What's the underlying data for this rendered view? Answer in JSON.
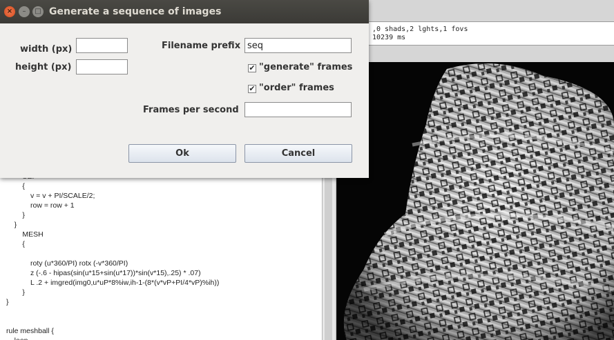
{
  "dialog": {
    "title": "Generate a sequence of images",
    "window_buttons": {
      "close": "×",
      "minimize": "–",
      "maximize": "□"
    },
    "width_label": "width (px)",
    "height_label": "height (px)",
    "width_value": "",
    "height_value": "",
    "prefix_label": "Filename prefix",
    "prefix_value": "seq",
    "generate_label": "\"generate\" frames",
    "generate_checked": true,
    "order_label": "\"order\" frames",
    "order_checked": true,
    "check_glyph": "✔",
    "fps_label": "Frames per second",
    "fps_value": "",
    "ok_label": "Ok",
    "cancel_label": "Cancel"
  },
  "status": {
    "line1": ",0 shads,2 lghts,1 fovs",
    "line2": "10239 ms"
  },
  "editor": {
    "code": "        SE!\n        {\n            v = v + PI/SCALE/2;\n            row = row + 1\n        }\n    }\n        MESH\n        {\n\n            roty (u*360/PI) rotx (-v*360/PI)\n            z (-.6 - hipas(sin(u*15+sin(u*17))*sin(v*15),.25) * .07)\n            L .2 + imgred(img0,u*uP*8%iw,ih-1-(8*(v*vP+PI/4*vP)%ih))\n        }\n}\n\n\nrule meshball {\n    loop"
  },
  "colors": {
    "titlebar": "#3b3a36",
    "close_button": "#e2561f",
    "dialog_bg": "#f0efed",
    "render_bg": "#050505"
  }
}
